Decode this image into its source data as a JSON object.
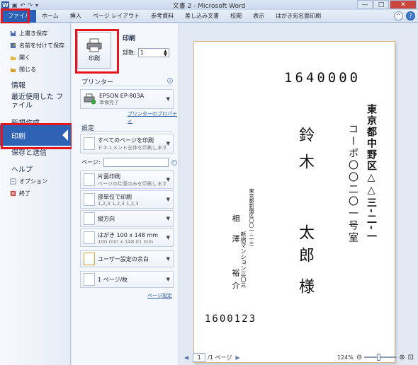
{
  "window": {
    "title": "文書 2 - Microsoft Word",
    "buttons": [
      "—",
      "□",
      "✕"
    ]
  },
  "ribbon": {
    "tabs": [
      "ファイル",
      "ホーム",
      "挿入",
      "ページ レイアウト",
      "参考資料",
      "差し込み文書",
      "校閲",
      "表示",
      "はがき宛名面印刷"
    ]
  },
  "backstage": {
    "items": [
      {
        "label": "上書き保存",
        "icon": "save-icon"
      },
      {
        "label": "名前を付けて保存",
        "icon": "save-as-icon"
      },
      {
        "label": "開く",
        "icon": "open-folder-icon"
      },
      {
        "label": "閉じる",
        "icon": "close-folder-icon"
      }
    ],
    "big_items": [
      "情報",
      "最近使用した ファイル",
      "新規作成",
      "印刷",
      "保存と送信",
      "ヘルプ"
    ],
    "bottom_items": [
      {
        "label": "オプション",
        "icon": "options-icon"
      },
      {
        "label": "終了",
        "icon": "exit-icon"
      }
    ]
  },
  "print_panel": {
    "heading": "印刷",
    "print_button_label": "印刷",
    "copies_label": "部数:",
    "copies_value": "1",
    "printer_heading": "プリンター",
    "printer_name": "EPSON EP-803A",
    "printer_status": "準備完了",
    "printer_properties_link": "プリンターのプロパティ",
    "settings_heading": "設定",
    "settings": [
      {
        "line1": "すべてのページを印刷",
        "line2": "ドキュメント全体を印刷します"
      },
      {
        "line1": "片面印刷",
        "line2": "ページの片面のみを印刷します"
      },
      {
        "line1": "部単位で印刷",
        "line2": "1,2,3    1,2,3    1,2,3"
      },
      {
        "line1": "縦方向",
        "line2": ""
      },
      {
        "line1": "はがき 100 x 148 mm",
        "line2": "100 mm x 148.01 mm"
      },
      {
        "line1": "ユーザー設定の余白",
        "line2": ""
      },
      {
        "line1": "1 ページ/枚",
        "line2": ""
      }
    ],
    "pages_label": "ページ:",
    "page_setup_link": "ページ設定"
  },
  "postcard": {
    "recipient_postal": "1640000",
    "recipient_address_1": "東京都中野区△△三-二-一",
    "recipient_address_2": "コーポ〇〇二〇一号室",
    "recipient_surname": "鈴木",
    "recipient_given": "太郎",
    "honorific": "様",
    "sender_address_1": "東京都新宿区〇〇一-二-三",
    "sender_address_2": "新宿マンション三〇三",
    "sender_surname": "相澤",
    "sender_given": "裕介",
    "sender_postal": "1600123"
  },
  "preview_bar": {
    "page_current": "1",
    "page_total": "/1 ページ",
    "zoom": "124%"
  }
}
